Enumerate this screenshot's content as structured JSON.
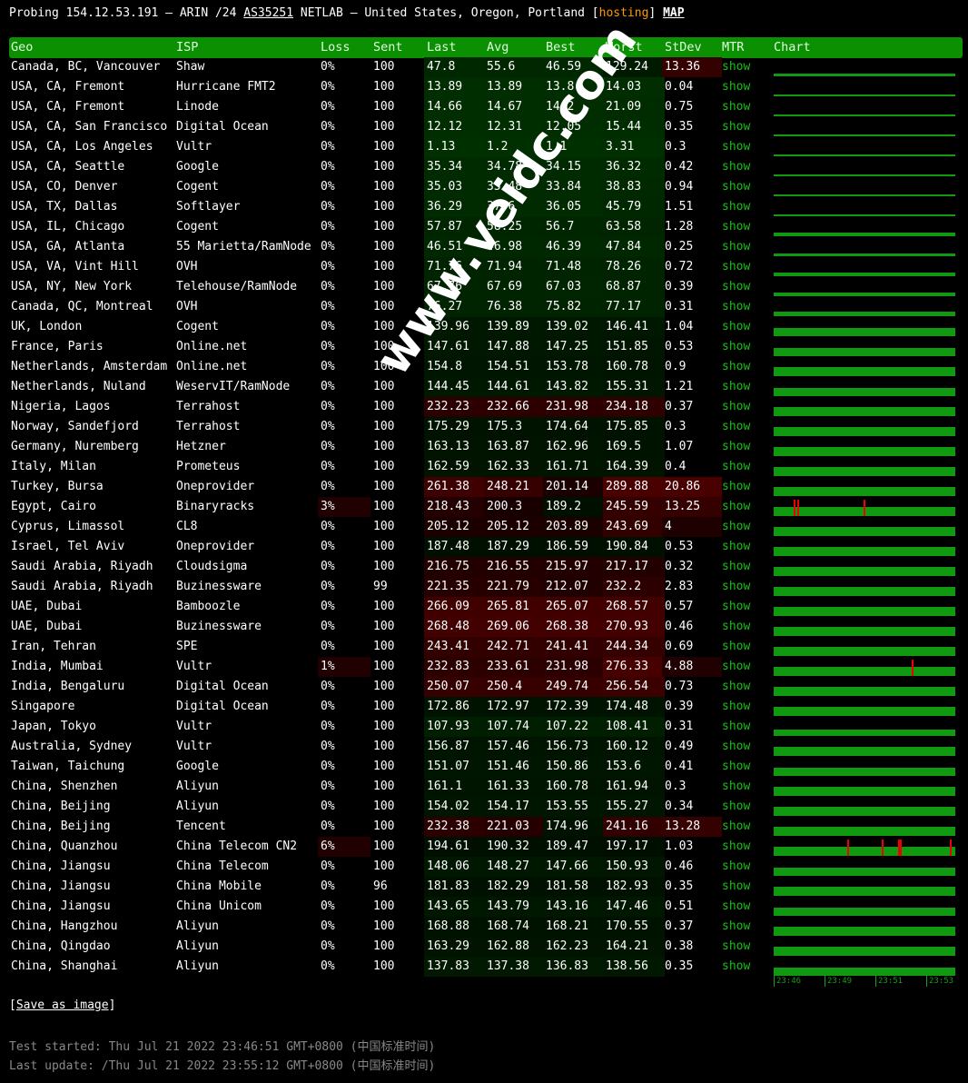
{
  "header": {
    "prefix": "Probing 154.12.53.191 – ARIN /24 ",
    "asn": "AS35251",
    "middle": " NETLAB – United States, Oregon, Portland [",
    "tag": "hosting",
    "suffix": "] ",
    "map": "MAP"
  },
  "columns": [
    "Geo",
    "ISP",
    "Loss",
    "Sent",
    "Last",
    "Avg",
    "Best",
    "Worst",
    "StDev",
    "MTR",
    "Chart"
  ],
  "mtr_label": "show",
  "rows": [
    [
      "Canada, BC, Vancouver",
      "Shaw",
      "0%",
      "100",
      "47.8",
      "55.6",
      "46.59",
      "129.24",
      "13.36"
    ],
    [
      "USA, CA, Fremont",
      "Hurricane FMT2",
      "0%",
      "100",
      "13.89",
      "13.89",
      "13.8",
      "14.03",
      "0.04"
    ],
    [
      "USA, CA, Fremont",
      "Linode",
      "0%",
      "100",
      "14.66",
      "14.67",
      "14.2",
      "21.09",
      "0.75"
    ],
    [
      "USA, CA, San Francisco",
      "Digital Ocean",
      "0%",
      "100",
      "12.12",
      "12.31",
      "12.05",
      "15.44",
      "0.35"
    ],
    [
      "USA, CA, Los Angeles",
      "Vultr",
      "0%",
      "100",
      "1.13",
      "1.2",
      "1.1",
      "3.31",
      "0.3"
    ],
    [
      "USA, CA, Seattle",
      "Google",
      "0%",
      "100",
      "35.34",
      "34.78",
      "34.15",
      "36.32",
      "0.42"
    ],
    [
      "USA, CO, Denver",
      "Cogent",
      "0%",
      "100",
      "35.03",
      "35.48",
      "33.84",
      "38.83",
      "0.94"
    ],
    [
      "USA, TX, Dallas",
      "Softlayer",
      "0%",
      "100",
      "36.29",
      "37.6",
      "36.05",
      "45.79",
      "1.51"
    ],
    [
      "USA, IL, Chicago",
      "Cogent",
      "0%",
      "100",
      "57.87",
      "58.25",
      "56.7",
      "63.58",
      "1.28"
    ],
    [
      "USA, GA, Atlanta",
      "55 Marietta/RamNode",
      "0%",
      "100",
      "46.51",
      "46.98",
      "46.39",
      "47.84",
      "0.25"
    ],
    [
      "USA, VA, Vint Hill",
      "OVH",
      "0%",
      "100",
      "71.76",
      "71.94",
      "71.48",
      "78.26",
      "0.72"
    ],
    [
      "USA, NY, New York",
      "Telehouse/RamNode",
      "0%",
      "100",
      "67.76",
      "67.69",
      "67.03",
      "68.87",
      "0.39"
    ],
    [
      "Canada, QC, Montreal",
      "OVH",
      "0%",
      "100",
      "76.27",
      "76.38",
      "75.82",
      "77.17",
      "0.31"
    ],
    [
      "UK, London",
      "Cogent",
      "0%",
      "100",
      "139.96",
      "139.89",
      "139.02",
      "146.41",
      "1.04"
    ],
    [
      "France, Paris",
      "Online.net",
      "0%",
      "100",
      "147.61",
      "147.88",
      "147.25",
      "151.85",
      "0.53"
    ],
    [
      "Netherlands, Amsterdam",
      "Online.net",
      "0%",
      "100",
      "154.8",
      "154.51",
      "153.78",
      "160.78",
      "0.9"
    ],
    [
      "Netherlands, Nuland",
      "WeservIT/RamNode",
      "0%",
      "100",
      "144.45",
      "144.61",
      "143.82",
      "155.31",
      "1.21"
    ],
    [
      "Nigeria, Lagos",
      "Terrahost",
      "0%",
      "100",
      "232.23",
      "232.66",
      "231.98",
      "234.18",
      "0.37"
    ],
    [
      "Norway, Sandefjord",
      "Terrahost",
      "0%",
      "100",
      "175.29",
      "175.3",
      "174.64",
      "175.85",
      "0.3"
    ],
    [
      "Germany, Nuremberg",
      "Hetzner",
      "0%",
      "100",
      "163.13",
      "163.87",
      "162.96",
      "169.5",
      "1.07"
    ],
    [
      "Italy, Milan",
      "Prometeus",
      "0%",
      "100",
      "162.59",
      "162.33",
      "161.71",
      "164.39",
      "0.4"
    ],
    [
      "Turkey, Bursa",
      "Oneprovider",
      "0%",
      "100",
      "261.38",
      "248.21",
      "201.14",
      "289.88",
      "20.86"
    ],
    [
      "Egypt, Cairo",
      "Binaryracks",
      "3%",
      "100",
      "218.43",
      "200.3",
      "189.2",
      "245.59",
      "13.25"
    ],
    [
      "Cyprus, Limassol",
      "CL8",
      "0%",
      "100",
      "205.12",
      "205.12",
      "203.89",
      "243.69",
      "4"
    ],
    [
      "Israel, Tel Aviv",
      "Oneprovider",
      "0%",
      "100",
      "187.48",
      "187.29",
      "186.59",
      "190.84",
      "0.53"
    ],
    [
      "Saudi Arabia, Riyadh",
      "Cloudsigma",
      "0%",
      "100",
      "216.75",
      "216.55",
      "215.97",
      "217.17",
      "0.32"
    ],
    [
      "Saudi Arabia, Riyadh",
      "Buzinessware",
      "0%",
      "99",
      "221.35",
      "221.79",
      "212.07",
      "232.2",
      "2.83"
    ],
    [
      "UAE, Dubai",
      "Bamboozle",
      "0%",
      "100",
      "266.09",
      "265.81",
      "265.07",
      "268.57",
      "0.57"
    ],
    [
      "UAE, Dubai",
      "Buzinessware",
      "0%",
      "100",
      "268.48",
      "269.06",
      "268.38",
      "270.93",
      "0.46"
    ],
    [
      "Iran, Tehran",
      "SPE",
      "0%",
      "100",
      "243.41",
      "242.71",
      "241.41",
      "244.34",
      "0.69"
    ],
    [
      "India, Mumbai",
      "Vultr",
      "1%",
      "100",
      "232.83",
      "233.61",
      "231.98",
      "276.33",
      "4.88"
    ],
    [
      "India, Bengaluru",
      "Digital Ocean",
      "0%",
      "100",
      "250.07",
      "250.4",
      "249.74",
      "256.54",
      "0.73"
    ],
    [
      "Singapore",
      "Digital Ocean",
      "0%",
      "100",
      "172.86",
      "172.97",
      "172.39",
      "174.48",
      "0.39"
    ],
    [
      "Japan, Tokyo",
      "Vultr",
      "0%",
      "100",
      "107.93",
      "107.74",
      "107.22",
      "108.41",
      "0.31"
    ],
    [
      "Australia, Sydney",
      "Vultr",
      "0%",
      "100",
      "156.87",
      "157.46",
      "156.73",
      "160.12",
      "0.49"
    ],
    [
      "Taiwan, Taichung",
      "Google",
      "0%",
      "100",
      "151.07",
      "151.46",
      "150.86",
      "153.6",
      "0.41"
    ],
    [
      "China, Shenzhen",
      "Aliyun",
      "0%",
      "100",
      "161.1",
      "161.33",
      "160.78",
      "161.94",
      "0.3"
    ],
    [
      "China, Beijing",
      "Aliyun",
      "0%",
      "100",
      "154.02",
      "154.17",
      "153.55",
      "155.27",
      "0.34"
    ],
    [
      "China, Beijing",
      "Tencent",
      "0%",
      "100",
      "232.38",
      "221.03",
      "174.96",
      "241.16",
      "13.28"
    ],
    [
      "China, Quanzhou",
      "China Telecom CN2",
      "6%",
      "100",
      "194.61",
      "190.32",
      "189.47",
      "197.17",
      "1.03"
    ],
    [
      "China, Jiangsu",
      "China Telecom",
      "0%",
      "100",
      "148.06",
      "148.27",
      "147.66",
      "150.93",
      "0.46"
    ],
    [
      "China, Jiangsu",
      "China Mobile",
      "0%",
      "96",
      "181.83",
      "182.29",
      "181.58",
      "182.93",
      "0.35"
    ],
    [
      "China, Jiangsu",
      "China Unicom",
      "0%",
      "100",
      "143.65",
      "143.79",
      "143.16",
      "147.46",
      "0.51"
    ],
    [
      "China, Hangzhou",
      "Aliyun",
      "0%",
      "100",
      "168.88",
      "168.74",
      "168.21",
      "170.55",
      "0.37"
    ],
    [
      "China, Qingdao",
      "Aliyun",
      "0%",
      "100",
      "163.29",
      "162.88",
      "162.23",
      "164.21",
      "0.38"
    ],
    [
      "China, Shanghai",
      "Aliyun",
      "0%",
      "100",
      "137.83",
      "137.38",
      "136.83",
      "138.56",
      "0.35"
    ]
  ],
  "loss_marks": {
    "22": [
      0.11,
      0.13,
      0.5
    ],
    "30": [
      0.77
    ],
    "39": [
      0.41,
      0.6,
      0.69,
      0.7,
      0.98
    ]
  },
  "chart_times": [
    "23:46",
    "23:49",
    "23:51",
    "23:53"
  ],
  "save_label": "Save as image",
  "footer": {
    "started": "Test started: Thu Jul 21 2022 23:46:51 GMT+0800 (中国标准时间)",
    "updated": "Last update: /Thu Jul 21 2022 23:55:12 GMT+0800 (中国标准时间)"
  },
  "watermark": "www.veidc.com"
}
